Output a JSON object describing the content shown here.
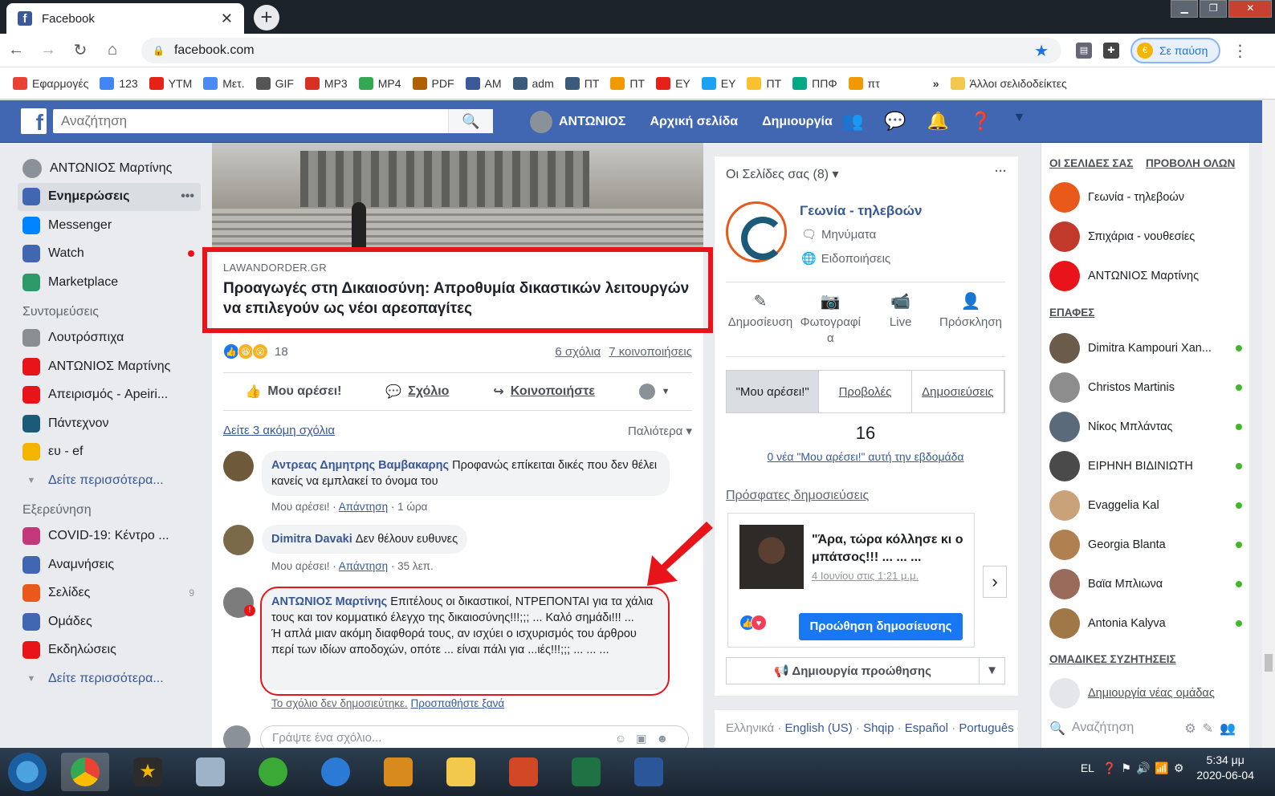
{
  "browser": {
    "tab_title": "Facebook",
    "tab_close": "✕",
    "new_tab": "+",
    "url": "facebook.com",
    "paused_label": "Σε παύση",
    "bookmarks": [
      {
        "label": "Εφαρμογές",
        "color": "#e94235"
      },
      {
        "label": "123",
        "color": "#4285f4"
      },
      {
        "label": "YTM",
        "color": "#e62117"
      },
      {
        "label": "Μετ.",
        "color": "#4a8af4"
      },
      {
        "label": "GIF",
        "color": "#555555"
      },
      {
        "label": "MP3",
        "color": "#d93025"
      },
      {
        "label": "MP4",
        "color": "#34a853"
      },
      {
        "label": "PDF",
        "color": "#b06000"
      },
      {
        "label": "AM",
        "color": "#3b5998"
      },
      {
        "label": "adm",
        "color": "#3c5a7a"
      },
      {
        "label": "ΠΤ",
        "color": "#3c5a7a"
      },
      {
        "label": "ΠΤ",
        "color": "#f29900"
      },
      {
        "label": "ΕΥ",
        "color": "#e62117"
      },
      {
        "label": "ΕΥ",
        "color": "#1da1f2"
      },
      {
        "label": "ΠΤ",
        "color": "#fbc02d"
      },
      {
        "label": "ΠΠΦ",
        "color": "#00a884"
      },
      {
        "label": "πτ",
        "color": "#f29900"
      }
    ],
    "bookmarks_overflow": "»",
    "other_bookmarks": "Άλλοι σελιδοδείκτες"
  },
  "fb": {
    "logo": "f",
    "search_placeholder": "Αναζήτηση",
    "user": "ΑΝΤΩΝΙΟΣ",
    "home": "Αρχική σελίδα",
    "create": "Δημιουργία"
  },
  "leftnav": {
    "profile": "ΑΝΤΩΝΙΟΣ Μαρτίνης",
    "main": [
      {
        "label": "Ενημερώσεις",
        "icon": "news-feed-icon",
        "color": "#4267b2"
      },
      {
        "label": "Messenger",
        "icon": "messenger-icon",
        "color": "#0084ff"
      },
      {
        "label": "Watch",
        "icon": "watch-icon",
        "color": "#4267b2"
      },
      {
        "label": "Marketplace",
        "icon": "marketplace-icon",
        "color": "#2e9a6a"
      }
    ],
    "feed_dots": "•••",
    "shortcuts_title": "Συντομεύσεις",
    "shortcuts": [
      {
        "label": "Λουτρόσπιχα",
        "color": "#8a8d91"
      },
      {
        "label": "ΑΝΤΩΝΙΟΣ Μαρτίνης",
        "color": "#e8141a"
      },
      {
        "label": "Απειρισμός - Apeiri...",
        "color": "#e8141a"
      },
      {
        "label": "Πάντεχνον",
        "color": "#1b5a78"
      },
      {
        "label": "ευ - ef",
        "color": "#f4b400"
      }
    ],
    "see_more": "Δείτε περισσότερα...",
    "explore_title": "Εξερεύνηση",
    "explore": [
      {
        "label": "COVID-19: Κέντρο ...",
        "color": "#c2387a",
        "count": ""
      },
      {
        "label": "Αναμνήσεις",
        "color": "#4267b2",
        "count": ""
      },
      {
        "label": "Σελίδες",
        "color": "#e8591a",
        "count": "9"
      },
      {
        "label": "Ομάδες",
        "color": "#4267b2",
        "count": ""
      },
      {
        "label": "Εκδηλώσεις",
        "color": "#e8141a",
        "count": ""
      }
    ],
    "see_more2": "Δείτε περισσότερα..."
  },
  "post": {
    "domain": "LAWANDORDER.GR",
    "headline": "Προαγωγές στη Δικαιοσύνη: Απροθυμία δικαστικών λειτουργών να επιλεγούν ως νέοι αρεοπαγίτες",
    "reaction_count": "18",
    "comments": "6 σχόλια",
    "shares": "7 κοινοποιήσεις",
    "like": "Μου αρέσει!",
    "comment": "Σχόλιο",
    "share": "Κοινοποιήστε",
    "more_comments": "Δείτε 3 ακόμη σχόλια",
    "sort": "Παλιότερα ▾",
    "c1": {
      "name": "Αντρεας Δημητρης Βαμβακαρης",
      "text": "Προφανώς επίκειται δικές που δεν θέλει κανείς να εμπλακεί το όνομα του",
      "like": "Μου αρέσει!",
      "reply": "Απάντηση",
      "time": "1 ώρα"
    },
    "c2": {
      "name": "Dimitra Davaki",
      "text": "Δεν θέλουν ευθυνες",
      "like": "Μου αρέσει!",
      "reply": "Απάντηση",
      "time": "35 λεπ."
    },
    "c3": {
      "name": "ΑΝΤΩΝΙΟΣ Μαρτίνης",
      "text": "Επιτέλους οι δικαστικοί, ΝΤΡΕΠΟΝΤΑΙ για τα χάλια τους και τον κομματικό έλεγχο της δικαιοσύνης!!!;;; ... Καλό σημάδι!!! ...",
      "text2": "Ή απλά μιαν ακόμη διαφθορά τους, αν ισχύει ο ισχυρισμός του άρθρου περί των ιδίων αποδοχών, οπότε ... είναι πάλι για ...ιές!!!;;; ... ... ...",
      "failed": "Το σχόλιο δεν δημοσιεύτηκε.",
      "retry": "Προσπαθήστε ξανά"
    },
    "write_placeholder": "Γράψτε ένα σχόλιο..."
  },
  "pages": {
    "header": "Οι Σελίδες σας (8) ▾",
    "dots": "···",
    "name": "Γεωνία - τηλεβοών",
    "messages": "Μηνύματα",
    "notifications": "Ειδοποιήσεις",
    "actions": [
      "Δημοσίευση",
      "Φωτογραφί α",
      "Live",
      "Πρόσκληση"
    ],
    "tabs": [
      "\"Μου αρέσει!\"",
      "Προβολές",
      "Δημοσιεύσεις"
    ],
    "likes": "16",
    "week": "0 νέα \"Μου αρέσει!\" αυτή την εβδομάδα",
    "recent": "Πρόσφατες δημοσιεύσεις",
    "post_text": "\"Άρα, τώρα κόλλησε κι ο μπάτσος!!! ... ... ...",
    "post_date": "4 Ιουνίου στις 1:21 μ.μ.",
    "boost": "Προώθηση δημοσίευσης",
    "create_promo": "Δημιουργία προώθησης"
  },
  "langs": {
    "current": "Ελληνικά",
    "others": [
      "English (US)",
      "Shqip",
      "Español",
      "Português (Brasil)"
    ]
  },
  "sidebar": {
    "your_pages": "ΟΙ ΣΕΛΙΔΕΣ ΣΑΣ",
    "see_all": "ΠΡΟΒΟΛΗ ΟΛΩΝ",
    "pages": [
      "Γεωνία - τηλεβοών",
      "Σπιχάρια - νουθεσίες",
      "ΑΝΤΩΝΙΟΣ Μαρτίνης"
    ],
    "contacts_title": "ΕΠΑΦΕΣ",
    "contacts": [
      "Dimitra Kampouri Xan...",
      "Christos Martinis",
      "Νίκος Μπλάντας",
      "ΕΙΡΗΝΗ ΒΙΔΙΝΙΩΤΗ",
      "Evaggelia Kal",
      "Georgia Blanta",
      "Βαϊα Μπλιωνα",
      "Antonia Kalyva"
    ],
    "groups_title": "ΟΜΑΔΙΚΕΣ ΣΥΖΗΤΗΣΕΙΣ",
    "new_group": "Δημιουργία νέας ομάδας",
    "search": "Αναζήτηση"
  },
  "taskbar": {
    "lang": "EL",
    "time": "5:34 μμ",
    "date": "2020-06-04"
  }
}
